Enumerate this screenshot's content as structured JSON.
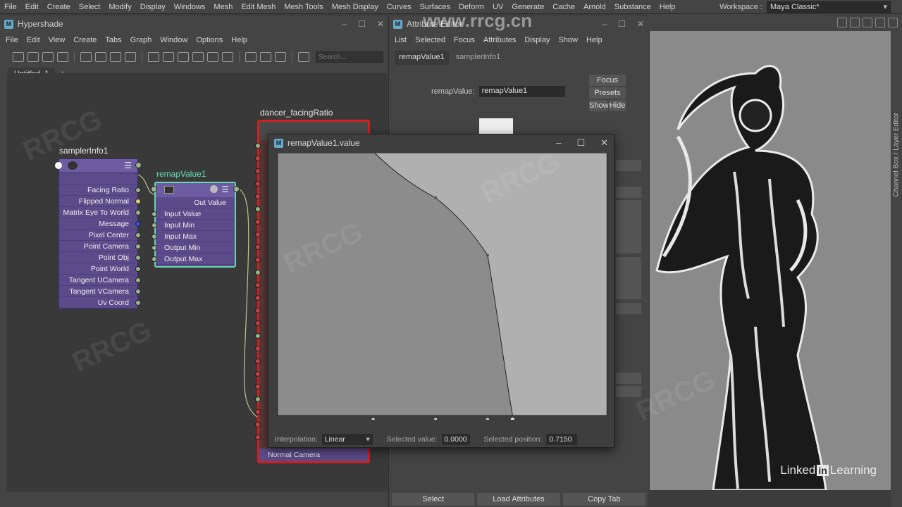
{
  "main_menu": [
    "File",
    "Edit",
    "Create",
    "Select",
    "Modify",
    "Display",
    "Windows",
    "Mesh",
    "Edit Mesh",
    "Mesh Tools",
    "Mesh Display",
    "Curves",
    "Surfaces",
    "Deform",
    "UV",
    "Generate",
    "Cache",
    "Arnold",
    "Substance",
    "Help"
  ],
  "workspace": {
    "label": "Workspace :",
    "value": "Maya Classic*"
  },
  "hypershade": {
    "title": "Hypershade",
    "menu": [
      "File",
      "Edit",
      "View",
      "Create",
      "Tabs",
      "Graph",
      "Window",
      "Options",
      "Help"
    ],
    "search_placeholder": "Search...",
    "tab": "Untitled_1",
    "tab_add": "+"
  },
  "nodes": {
    "sampler": {
      "name": "samplerInfo1",
      "attrs": [
        "Facing Ratio",
        "Flipped Normal",
        "Matrix Eye To World",
        "Message",
        "Pixel Center",
        "Point Camera",
        "Point Obj",
        "Point World",
        "Tangent UCamera",
        "Tangent VCamera",
        "Uv Coord"
      ]
    },
    "remap": {
      "name": "remapValue1",
      "out": "Out Value",
      "inputs": [
        "Input Value",
        "Input Min",
        "Input Max",
        "Output Min",
        "Output Max"
      ]
    },
    "dancer": {
      "name": "dancer_facingRatio",
      "footer": "Normal Camera"
    }
  },
  "attr_editor": {
    "title": "Attribute Editor",
    "menu": [
      "List",
      "Selected",
      "Focus",
      "Attributes",
      "Display",
      "Show",
      "Help"
    ],
    "tabs": [
      "remapValue1",
      "samplerInfo1"
    ],
    "field_label": "remapValue:",
    "field_value": "remapValue1",
    "focus": "Focus",
    "presets": "Presets",
    "show": "Show",
    "hide": "Hide",
    "bottom": [
      "Select",
      "Load Attributes",
      "Copy Tab"
    ]
  },
  "dialog": {
    "title": "remapValue1.value",
    "interp_label": "Interpolation:",
    "interp_value": "Linear",
    "sel_value_label": "Selected value:",
    "sel_value": "0.0000",
    "sel_pos_label": "Selected position:",
    "sel_pos": "0.7150"
  },
  "right_panel_tab": "Channel Box / Layer Editor",
  "brand": {
    "pre": "Linked",
    "in": "in",
    "post": "Learning"
  },
  "watermark_url": "www.rrcg.cn"
}
